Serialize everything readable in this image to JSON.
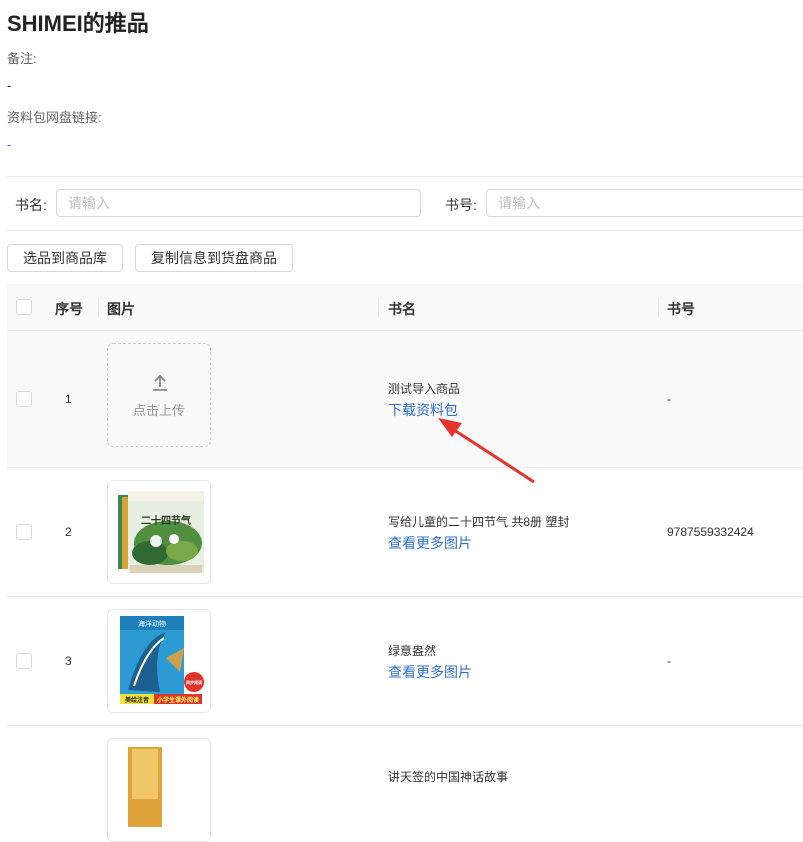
{
  "page": {
    "title": "SHIMEI的推品",
    "note_label": "备注:",
    "note_value": "-",
    "pan_label": "资料包网盘链接:",
    "pan_value": "-"
  },
  "filters": {
    "book_name_label": "书名:",
    "book_name_placeholder": "请输入",
    "book_no_label": "书号:",
    "book_no_placeholder": "请输入"
  },
  "actions": {
    "select_to_library": "选品到商品库",
    "copy_to_goods": "复制信息到货盘商品"
  },
  "table": {
    "headers": [
      "序号",
      "图片",
      "书名",
      "书号"
    ],
    "upload_text": "点击上传",
    "rows": [
      {
        "index": "1",
        "name": "测试导入商品",
        "link": "下载资料包",
        "isbn": "-"
      },
      {
        "index": "2",
        "name": "写给儿童的二十四节气 共8册 塑封",
        "link": "查看更多图片",
        "isbn": "9787559332424"
      },
      {
        "index": "3",
        "name": "绿意盎然",
        "link": "查看更多图片",
        "isbn": "-"
      },
      {
        "index": "",
        "name": "讲天签的中国神话故事",
        "link": "",
        "isbn": ""
      }
    ]
  },
  "cover2": {
    "banner": "二十四节气"
  },
  "cover3": {
    "banner": "海洋动物",
    "badge1": "美绘注音",
    "badge2": "小学生课外阅读",
    "badge3": "同步阅读"
  },
  "colors": {
    "link": "#2f6fd1",
    "arrow": "#e8332a"
  }
}
